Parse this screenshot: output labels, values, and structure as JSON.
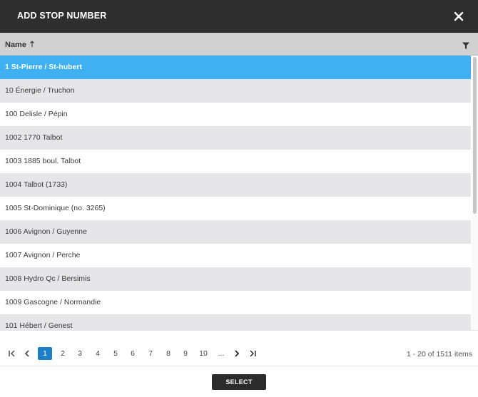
{
  "dialog": {
    "title": "ADD STOP NUMBER",
    "close_icon": "close-icon"
  },
  "grid": {
    "column_name": "Name",
    "sort_direction": "ascending",
    "sort_icon": "arrow-up-icon",
    "filter_icon": "filter-icon",
    "selected_index": 0,
    "rows": [
      "1 St-Pierre / St-hubert",
      "10 Énergie / Truchon",
      "100 Delisle / Pépin",
      "1002 1770 Talbot",
      "1003 1885 boul. Talbot",
      "1004 Talbot (1733)",
      "1005 St-Dominique (no. 3265)",
      "1006 Avignon / Guyenne",
      "1007 Avignon / Perche",
      "1008 Hydro Qc / Bersimis",
      "1009 Gascogne / Normandie",
      "101 Hébert / Genest"
    ]
  },
  "pager": {
    "first_icon": "first-page-icon",
    "prev_icon": "chevron-left-icon",
    "next_icon": "chevron-right-icon",
    "last_icon": "last-page-icon",
    "pages": [
      "1",
      "2",
      "3",
      "4",
      "5",
      "6",
      "7",
      "8",
      "9",
      "10",
      "..."
    ],
    "current_page": "1",
    "info": "1 - 20 of 1511 items"
  },
  "footer": {
    "select_label": "SELECT"
  },
  "colors": {
    "header_bg": "#2e2e2e",
    "selected_row": "#3fb1f2",
    "alt_row": "#e6e6e9",
    "current_page": "#1e7ec8",
    "button_bg": "#2b2b2b"
  }
}
